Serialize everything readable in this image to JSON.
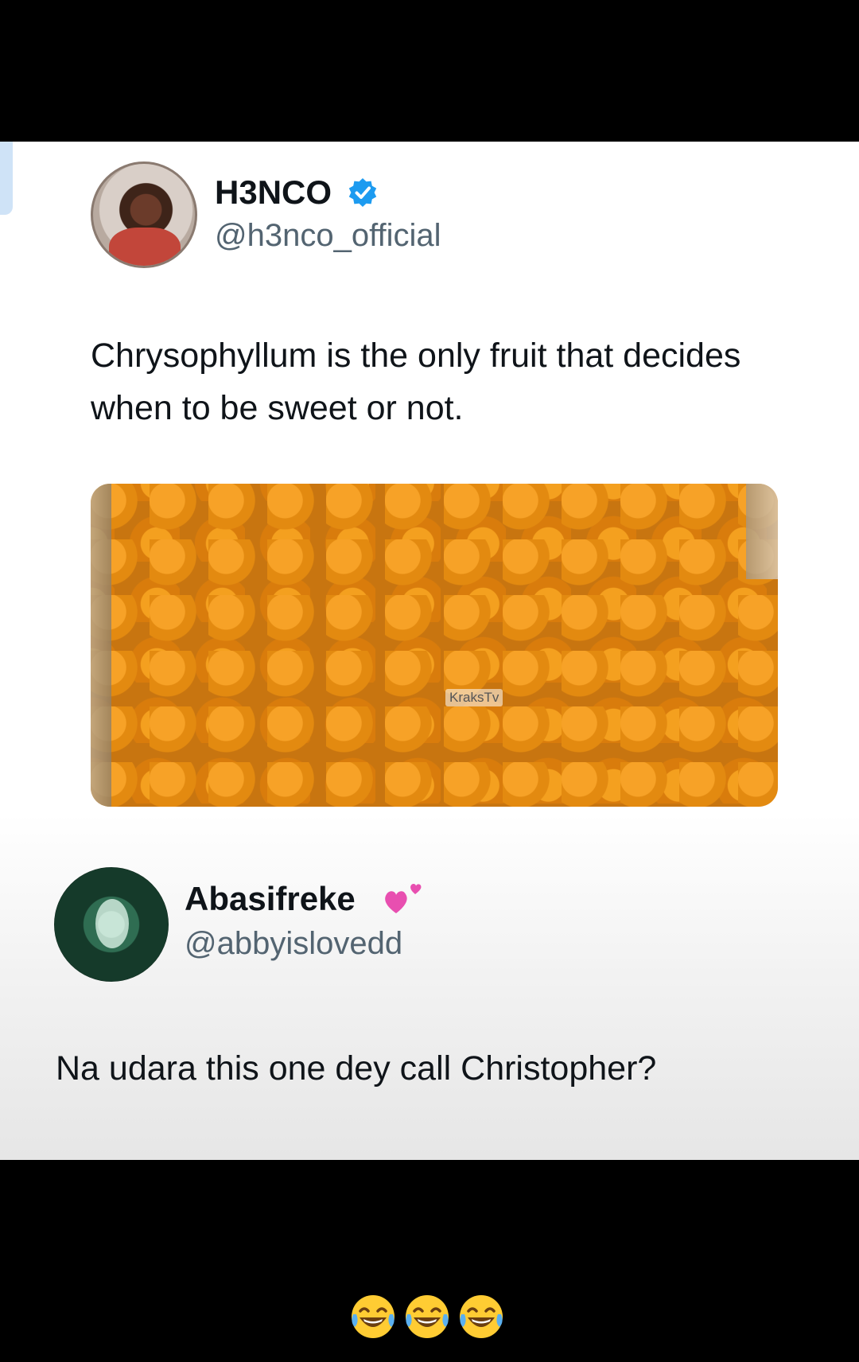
{
  "tweet": {
    "author_name": "H3NCO",
    "author_handle": "@h3nco_official",
    "text": "Chrysophyllum is the only fruit that decides when to be sweet or not.",
    "image_watermark": "KraksTv"
  },
  "reply": {
    "author_name": "Abasifreke",
    "author_handle": "@abbyislovedd",
    "text": "Na udara this one dey call Christopher?"
  },
  "footer": {
    "emoji_icons": [
      "laughing-crying-face-icon",
      "laughing-crying-face-icon",
      "laughing-crying-face-icon"
    ]
  },
  "colors": {
    "verified_badge": "#1d9bf0",
    "heart": "#e84fb0",
    "name_text": "#0f1419",
    "handle_text": "#536471"
  }
}
